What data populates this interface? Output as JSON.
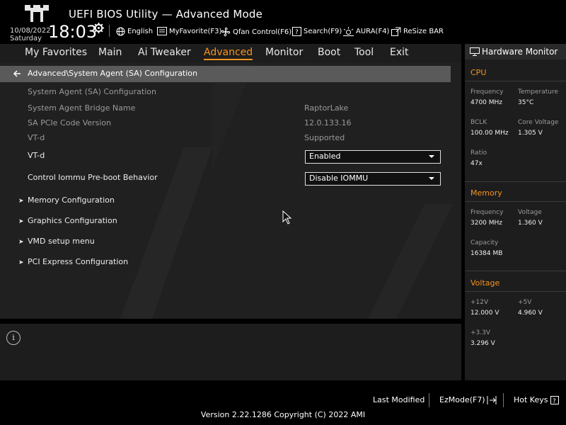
{
  "header": {
    "title": "UEFI BIOS Utility — Advanced Mode",
    "date": "10/08/2022",
    "day": "Saturday",
    "time": "18:03",
    "toolbar": [
      {
        "label": "English",
        "icon": "globe-icon"
      },
      {
        "label": "MyFavorite(F3)",
        "icon": "favorite-icon"
      },
      {
        "label": "Qfan Control(F6)",
        "icon": "fan-icon"
      },
      {
        "label": "Search(F9)",
        "icon": "search-icon"
      },
      {
        "label": "AURA(F4)",
        "icon": "aura-icon"
      },
      {
        "label": "ReSize BAR",
        "icon": "resize-bar-icon"
      }
    ]
  },
  "nav": {
    "tabs": [
      {
        "label": "My Favorites",
        "active": false
      },
      {
        "label": "Main",
        "active": false
      },
      {
        "label": "Ai Tweaker",
        "active": false
      },
      {
        "label": "Advanced",
        "active": true
      },
      {
        "label": "Monitor",
        "active": false
      },
      {
        "label": "Boot",
        "active": false
      },
      {
        "label": "Tool",
        "active": false
      },
      {
        "label": "Exit",
        "active": false
      }
    ]
  },
  "main": {
    "breadcrumb": "Advanced\\System Agent (SA) Configuration",
    "section_title": "System Agent (SA) Configuration",
    "info_rows": [
      {
        "label": "System Agent Bridge Name",
        "value": "RaptorLake"
      },
      {
        "label": "SA PCIe Code Version",
        "value": "12.0.133.16"
      },
      {
        "label": "VT-d",
        "value": "Supported"
      }
    ],
    "settings": [
      {
        "label": "VT-d",
        "value": "Enabled"
      },
      {
        "label": "Control Iommu Pre-boot Behavior",
        "value": "Disable IOMMU"
      }
    ],
    "submenus": [
      "Memory Configuration",
      "Graphics Configuration",
      "VMD setup menu",
      "PCI Express Configuration"
    ]
  },
  "hardware_monitor": {
    "title": "Hardware Monitor",
    "cpu": {
      "title": "CPU",
      "frequency_label": "Frequency",
      "frequency": "4700 MHz",
      "temperature_label": "Temperature",
      "temperature": "35°C",
      "bclk_label": "BCLK",
      "bclk": "100.00 MHz",
      "core_voltage_label": "Core Voltage",
      "core_voltage": "1.305 V",
      "ratio_label": "Ratio",
      "ratio": "47x"
    },
    "memory": {
      "title": "Memory",
      "frequency_label": "Frequency",
      "frequency": "3200 MHz",
      "voltage_label": "Voltage",
      "voltage": "1.360 V",
      "capacity_label": "Capacity",
      "capacity": "16384 MB"
    },
    "voltage": {
      "title": "Voltage",
      "v12_label": "+12V",
      "v12": "12.000 V",
      "v5_label": "+5V",
      "v5": "4.960 V",
      "v33_label": "+3.3V",
      "v33": "3.296 V"
    }
  },
  "footer": {
    "last_modified": "Last Modified",
    "ezmode": "EzMode(F7)",
    "hotkeys": "Hot Keys",
    "version": "Version 2.22.1286 Copyright (C) 2022 AMI"
  },
  "colors": {
    "accent": "#f7931e",
    "background": "#000000",
    "panel": "#202020"
  }
}
